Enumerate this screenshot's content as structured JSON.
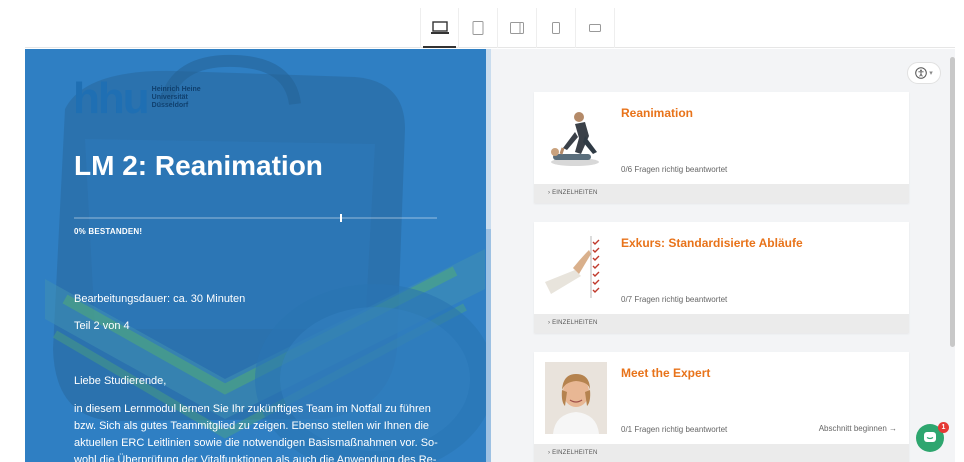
{
  "toolbar": {
    "devices": [
      {
        "name": "desktop",
        "active": true
      },
      {
        "name": "tablet-portrait",
        "active": false
      },
      {
        "name": "tablet-landscape",
        "active": false
      },
      {
        "name": "phone-portrait",
        "active": false
      },
      {
        "name": "phone-landscape",
        "active": false
      }
    ]
  },
  "hero": {
    "logo_mark": "hhu",
    "logo_lines": [
      "Heinrich Heine",
      "Universität",
      "Düsseldorf"
    ],
    "title": "LM 2: Reanimation",
    "progress_percent": 0,
    "status_label": "0% BESTANDEN!",
    "duration": "Bearbeitungsdauer: ca. 30 Minuten",
    "part": "Teil 2 von 4",
    "greeting": "Liebe Studierende,",
    "body": "in diesem Lernmodul lernen Sie Ihr zukünftiges Team im Notfall zu führen bzw. Sich als gutes Teammitglied zu zeigen. Ebenso stellen wir Ihnen die aktuellen ERC Leitlinien sowie die notwendigen Basismaßnahmen vor. So-wohl die Überprüfung der Vitalfunktionen als auch die Anwendung des Re-",
    "colors": {
      "background": "#2f7fc3",
      "text": "#ffffff"
    }
  },
  "cards": [
    {
      "title": "Reanimation",
      "status": "0/6 Fragen richtig beantwortet",
      "action": "",
      "footer": "› EINZELHEITEN",
      "image": "cpr-image"
    },
    {
      "title": "Exkurs: Standardisierte Abläufe",
      "status": "0/7 Fragen richtig beantwortet",
      "action": "",
      "footer": "› EINZELHEITEN",
      "image": "checklist-image"
    },
    {
      "title": "Meet the Expert",
      "status": "0/1 Fragen richtig beantwortet",
      "action": "Abschnitt beginnen →",
      "footer": "› EINZELHEITEN",
      "image": "expert-portrait"
    }
  ],
  "chat": {
    "badge_count": "1"
  },
  "accent_color": "#e8731a"
}
